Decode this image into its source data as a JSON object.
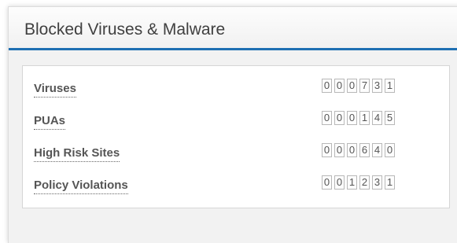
{
  "panel": {
    "title": "Blocked Viruses & Malware"
  },
  "stats": [
    {
      "label": "Viruses",
      "digits": [
        "0",
        "0",
        "0",
        "7",
        "3",
        "1"
      ]
    },
    {
      "label": "PUAs",
      "digits": [
        "0",
        "0",
        "0",
        "1",
        "4",
        "5"
      ]
    },
    {
      "label": "High Risk Sites",
      "digits": [
        "0",
        "0",
        "0",
        "6",
        "4",
        "0"
      ]
    },
    {
      "label": "Policy Violations",
      "digits": [
        "0",
        "0",
        "1",
        "2",
        "3",
        "1"
      ]
    }
  ],
  "colors": {
    "header_underline": "#1f6fb2",
    "title_text": "#404040",
    "label_text": "#555555",
    "body_background": "#f2f2f2"
  }
}
